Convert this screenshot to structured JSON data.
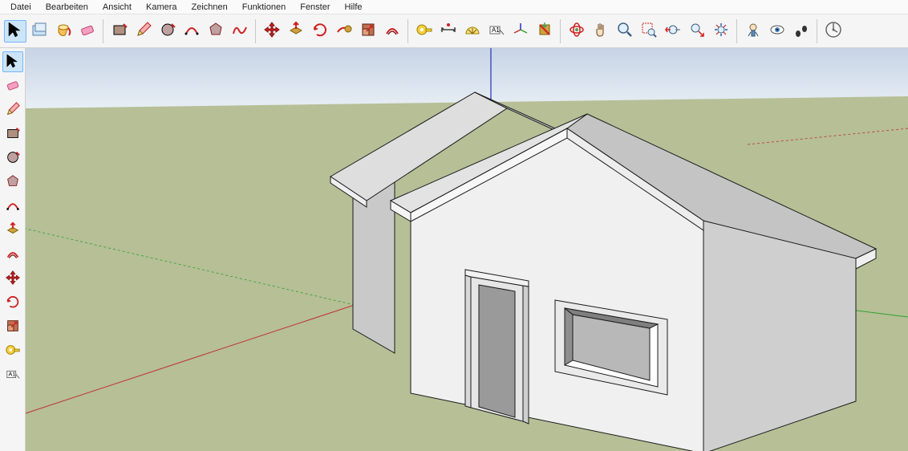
{
  "menu": {
    "items": [
      "Datei",
      "Bearbeiten",
      "Ansicht",
      "Kamera",
      "Zeichnen",
      "Funktionen",
      "Fenster",
      "Hilfe"
    ]
  },
  "toolbar_top": [
    {
      "name": "select-tool",
      "icon": "cursor",
      "selected": true
    },
    {
      "name": "make-component",
      "icon": "component"
    },
    {
      "name": "paint-bucket",
      "icon": "bucket"
    },
    {
      "name": "eraser",
      "icon": "eraser"
    },
    {
      "name": "sep"
    },
    {
      "name": "rectangle-tool",
      "icon": "rectangle"
    },
    {
      "name": "line-tool",
      "icon": "pencil"
    },
    {
      "name": "circle-tool",
      "icon": "circle"
    },
    {
      "name": "arc-tool",
      "icon": "arc"
    },
    {
      "name": "polygon-tool",
      "icon": "polygon"
    },
    {
      "name": "freehand-tool",
      "icon": "freehand"
    },
    {
      "name": "sep"
    },
    {
      "name": "move-tool",
      "icon": "move"
    },
    {
      "name": "push-pull",
      "icon": "pushpull"
    },
    {
      "name": "rotate-tool",
      "icon": "rotate"
    },
    {
      "name": "follow-me",
      "icon": "followme"
    },
    {
      "name": "scale-tool",
      "icon": "scale"
    },
    {
      "name": "offset-tool",
      "icon": "offset"
    },
    {
      "name": "sep"
    },
    {
      "name": "tape-measure",
      "icon": "tape"
    },
    {
      "name": "dimension-tool",
      "icon": "dimension"
    },
    {
      "name": "protractor",
      "icon": "protractor"
    },
    {
      "name": "text-tool",
      "icon": "text"
    },
    {
      "name": "axes-tool",
      "icon": "axes"
    },
    {
      "name": "section-plane",
      "icon": "section"
    },
    {
      "name": "sep"
    },
    {
      "name": "orbit",
      "icon": "orbit"
    },
    {
      "name": "pan",
      "icon": "pan"
    },
    {
      "name": "zoom",
      "icon": "zoom"
    },
    {
      "name": "zoom-window",
      "icon": "zoomwin"
    },
    {
      "name": "previous-view",
      "icon": "prev"
    },
    {
      "name": "next-view",
      "icon": "next"
    },
    {
      "name": "zoom-extents",
      "icon": "extents"
    },
    {
      "name": "sep"
    },
    {
      "name": "position-camera",
      "icon": "camera"
    },
    {
      "name": "look-around",
      "icon": "look"
    },
    {
      "name": "walk",
      "icon": "walk"
    },
    {
      "name": "sep"
    },
    {
      "name": "model-info",
      "icon": "info"
    }
  ],
  "toolbar_left": [
    {
      "name": "select-tool",
      "icon": "cursor",
      "selected": true
    },
    {
      "name": "eraser",
      "icon": "eraser"
    },
    {
      "name": "line-tool",
      "icon": "pencil"
    },
    {
      "name": "rectangle-tool",
      "icon": "rectangle"
    },
    {
      "name": "circle-tool",
      "icon": "circle"
    },
    {
      "name": "polygon-tool",
      "icon": "polygon"
    },
    {
      "name": "arc-tool",
      "icon": "arc"
    },
    {
      "name": "push-pull",
      "icon": "pushpull"
    },
    {
      "name": "offset-tool",
      "icon": "offset"
    },
    {
      "name": "move-tool",
      "icon": "move"
    },
    {
      "name": "rotate-tool",
      "icon": "rotate"
    },
    {
      "name": "scale-tool",
      "icon": "scale"
    },
    {
      "name": "tape-measure",
      "icon": "tape"
    },
    {
      "name": "text-tool",
      "icon": "text"
    }
  ],
  "scene": {
    "axis_colors": {
      "x": "#c03030",
      "y": "#30a030",
      "z": "#2030c0"
    },
    "ground_color": "#b6bf96",
    "sky_top": "#c7d4e6",
    "sky_bottom": "#e8eef4",
    "model": "house"
  }
}
